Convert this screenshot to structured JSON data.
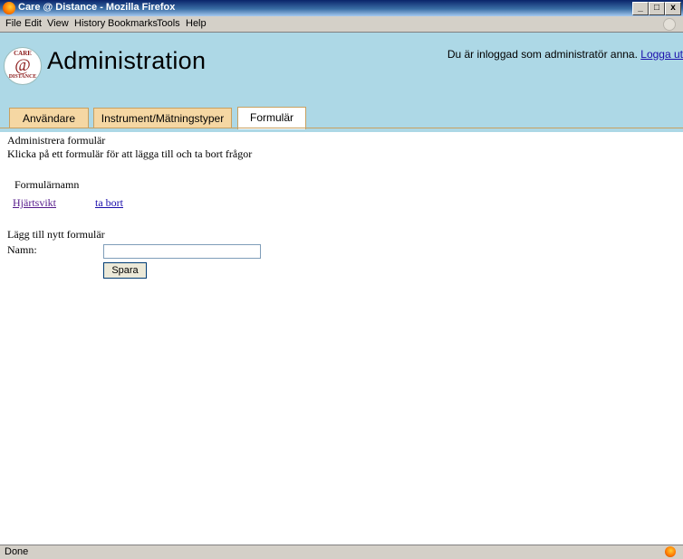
{
  "window": {
    "title": "Care @ Distance - Mozilla Firefox",
    "minimize": "_",
    "maximize": "□",
    "close": "x"
  },
  "menubar": {
    "items": [
      "File",
      "Edit",
      "View",
      "History",
      "Bookmarks",
      "Tools",
      "Help"
    ]
  },
  "header": {
    "logo": {
      "top": "CARE",
      "at": "@",
      "bottom": "DISTANCE"
    },
    "title": "Administration",
    "login_text": "Du är inloggad som administratör anna.",
    "logout_link": "Logga ut"
  },
  "tabs": [
    {
      "label": "Användare",
      "active": false
    },
    {
      "label": "Instrument/Mätningstyper",
      "active": false
    },
    {
      "label": "Formulär",
      "active": true
    }
  ],
  "main": {
    "heading": "Administrera formulär",
    "instructions": "Klicka på ett formulär för att lägga till och ta bort frågor",
    "column_header": "Formulärnamn",
    "forms": [
      {
        "name": "Hjärtsvikt",
        "delete_label": "ta bort"
      }
    ],
    "add_heading": "Lägg till nytt formulär",
    "name_label": "Namn:",
    "name_value": "",
    "save_label": "Spara"
  },
  "status": {
    "text": "Done"
  },
  "colors": {
    "header_bg": "#add8e6",
    "tab_bg": "#f5d7a3",
    "tab_border": "#c8a060",
    "link": "#551a8b"
  }
}
